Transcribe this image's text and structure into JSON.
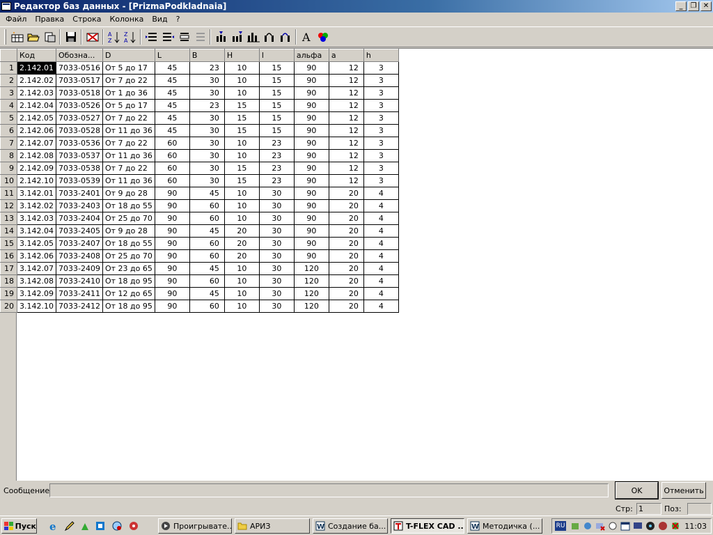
{
  "window": {
    "title": "Редактор баз данных - [PrizmaPodkladnaia]",
    "buttons": {
      "minimize": "_",
      "restore": "❐",
      "close": "✕"
    }
  },
  "menu": [
    "Файл",
    "Правка",
    "Строка",
    "Колонка",
    "Вид",
    "?"
  ],
  "toolbar_icons": [
    "new-table-icon",
    "open-folder-icon",
    "open-recent-icon",
    "save-icon",
    "delete-table-icon",
    "sort-ascending-icon",
    "sort-descending-icon",
    "insert-row-icon",
    "append-row-icon",
    "duplicate-row-icon",
    "delete-row-icon",
    "insert-column-icon",
    "append-column-icon",
    "column-chart-icon",
    "column-props-icon",
    "delete-column-icon",
    "font-icon",
    "color-icon"
  ],
  "grid": {
    "columns": [
      "Код",
      "Обозна...",
      "D",
      "L",
      "B",
      "H",
      "l",
      "альфа",
      "a",
      "h"
    ],
    "rows": [
      [
        "1",
        "2.142.01",
        "7033-0516",
        "От 5 до 17",
        "45",
        "23",
        "10",
        "15",
        "90",
        "12",
        "3"
      ],
      [
        "2",
        "2.142.02",
        "7033-0517",
        "От 7 до 22",
        "45",
        "30",
        "10",
        "15",
        "90",
        "12",
        "3"
      ],
      [
        "3",
        "2.142.03",
        "7033-0518",
        "От 1 до 36",
        "45",
        "30",
        "10",
        "15",
        "90",
        "12",
        "3"
      ],
      [
        "4",
        "2.142.04",
        "7033-0526",
        "От 5 до 17",
        "45",
        "23",
        "15",
        "15",
        "90",
        "12",
        "3"
      ],
      [
        "5",
        "2.142.05",
        "7033-0527",
        "От 7 до 22",
        "45",
        "30",
        "15",
        "15",
        "90",
        "12",
        "3"
      ],
      [
        "6",
        "2.142.06",
        "7033-0528",
        "От 11 до 36",
        "45",
        "30",
        "15",
        "15",
        "90",
        "12",
        "3"
      ],
      [
        "7",
        "2.142.07",
        "7033-0536",
        "От 7 до 22",
        "60",
        "30",
        "10",
        "23",
        "90",
        "12",
        "3"
      ],
      [
        "8",
        "2.142.08",
        "7033-0537",
        "От 11 до 36",
        "60",
        "30",
        "10",
        "23",
        "90",
        "12",
        "3"
      ],
      [
        "9",
        "2.142.09",
        "7033-0538",
        "От 7 до 22",
        "60",
        "30",
        "15",
        "23",
        "90",
        "12",
        "3"
      ],
      [
        "10",
        "2.142.10",
        "7033-0539",
        "От 11 до 36",
        "60",
        "30",
        "15",
        "23",
        "90",
        "12",
        "3"
      ],
      [
        "11",
        "3.142.01",
        "7033-2401",
        "От 9 до 28",
        "90",
        "45",
        "10",
        "30",
        "90",
        "20",
        "4"
      ],
      [
        "12",
        "3.142.02",
        "7033-2403",
        "От 18 до 55",
        "90",
        "60",
        "10",
        "30",
        "90",
        "20",
        "4"
      ],
      [
        "13",
        "3.142.03",
        "7033-2404",
        "От 25 до 70",
        "90",
        "60",
        "10",
        "30",
        "90",
        "20",
        "4"
      ],
      [
        "14",
        "3.142.04",
        "7033-2405",
        "От 9 до 28",
        "90",
        "45",
        "20",
        "30",
        "90",
        "20",
        "4"
      ],
      [
        "15",
        "3.142.05",
        "7033-2407",
        "От 18 до 55",
        "90",
        "60",
        "20",
        "30",
        "90",
        "20",
        "4"
      ],
      [
        "16",
        "3.142.06",
        "7033-2408",
        "От 25 до 70",
        "90",
        "60",
        "20",
        "30",
        "90",
        "20",
        "4"
      ],
      [
        "17",
        "3.142.07",
        "7033-2409",
        "От 23 до 65",
        "90",
        "45",
        "10",
        "30",
        "120",
        "20",
        "4"
      ],
      [
        "18",
        "3.142.08",
        "7033-2410",
        "От 18 до 95",
        "90",
        "60",
        "10",
        "30",
        "120",
        "20",
        "4"
      ],
      [
        "19",
        "3.142.09",
        "7033-2411",
        "От 12 до 65",
        "90",
        "45",
        "10",
        "30",
        "120",
        "20",
        "4"
      ],
      [
        "20",
        "3.142.10",
        "7033-2412",
        "От 18 до 95",
        "90",
        "60",
        "10",
        "30",
        "120",
        "20",
        "4"
      ]
    ],
    "selected_cell": "2.142.01"
  },
  "message": {
    "label": "Сообщение:",
    "value": ""
  },
  "buttons": {
    "ok": "OK",
    "cancel": "Отменить"
  },
  "status": {
    "page_label": "Стр:",
    "page_value": "1",
    "pos_label": "Поз:",
    "pos_value": ""
  },
  "taskbar": {
    "start": "Пуск",
    "tasks": [
      "Проигрывате...",
      "АРИЗ",
      "Создание ба...",
      "T-FLEX CAD ...",
      "Методичка (..."
    ],
    "active_task": 3,
    "lang": "RU",
    "clock": "11:03"
  },
  "colors": {
    "titlebar_start": "#0a246a",
    "titlebar_end": "#a6caf0",
    "face": "#d4d0c8"
  }
}
